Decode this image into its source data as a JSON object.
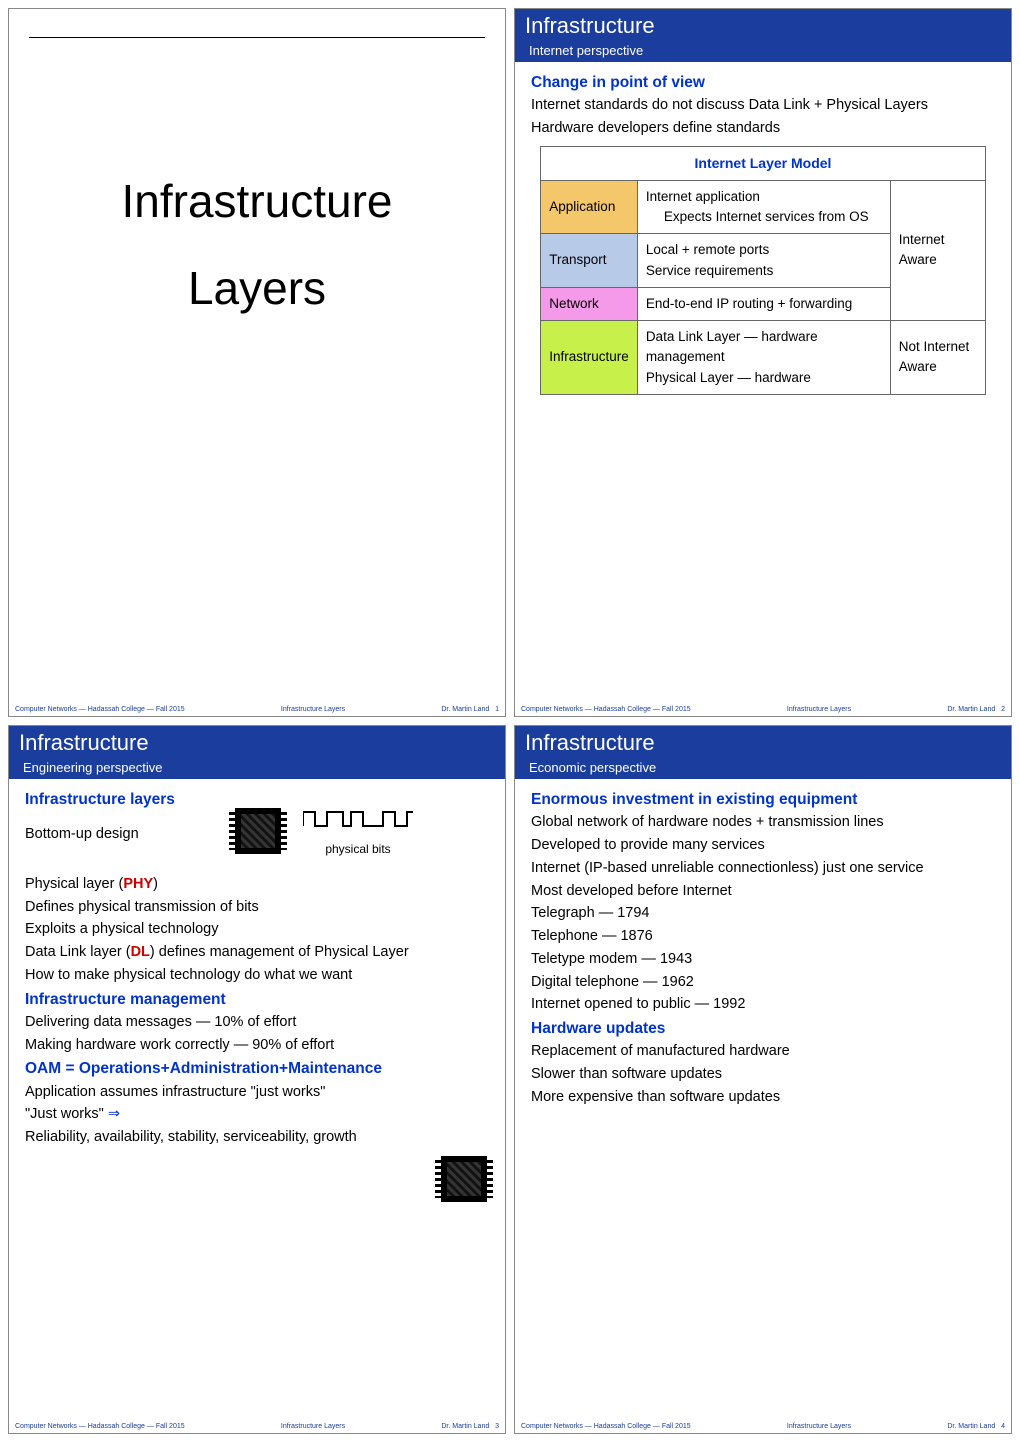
{
  "footer": {
    "left": "Computer Networks — Hadassah College — Fall 2015",
    "center": "Infrastructure Layers",
    "right": "Dr. Martin Land"
  },
  "slide1": {
    "title_line1": "Infrastructure",
    "title_line2": "Layers",
    "page": "1"
  },
  "slide2": {
    "hdr": "Infrastructure",
    "sub": "Internet perspective",
    "h1": "Change in point of view",
    "p1": "Internet standards do not discuss Data Link + Physical Layers",
    "p2": "Hardware developers define standards",
    "table_caption": "Internet Layer Model",
    "rows": [
      {
        "layer": "Application",
        "desc1": "Internet application",
        "desc2": "Expects Internet services from OS"
      },
      {
        "layer": "Transport",
        "desc1": "Local + remote ports",
        "desc2": "Service requirements"
      },
      {
        "layer": "Network",
        "desc1": "End-to-end IP routing + forwarding",
        "desc2": ""
      },
      {
        "layer": "Infrastructure",
        "desc1": "Data Link Layer — hardware management",
        "desc2": "Physical Layer — hardware"
      }
    ],
    "right_top": "Internet Aware",
    "right_bot": "Not Internet Aware",
    "page": "2"
  },
  "slide3": {
    "hdr": "Infrastructure",
    "sub": "Engineering perspective",
    "h1": "Infrastructure layers",
    "p1": "Bottom-up design",
    "p2a": "Physical layer (",
    "p2b": "PHY",
    "p2c": ")",
    "p3": "Defines physical transmission of bits",
    "p4": "Exploits a physical technology",
    "p5a": "Data Link layer (",
    "p5b": "DL",
    "p5c": ") defines management of Physical Layer",
    "p6": "How to make physical technology do what we want",
    "h2": "Infrastructure management",
    "p7": "Delivering data messages — 10% of effort",
    "p8": "Making hardware work correctly — 90% of effort",
    "h3": "OAM = Operations+Administration+Maintenance",
    "p9": "Application assumes infrastructure \"just works\"",
    "p10a": "\"Just works\" ",
    "p10b": "⇒",
    "p11": "Reliability, availability, stability, serviceability, growth",
    "sig_wave": "⨅⨅_⨅⨅⎺⨅⨅⨅",
    "sig_label": "physical bits",
    "page": "3"
  },
  "slide4": {
    "hdr": "Infrastructure",
    "sub": "Economic perspective",
    "h1": "Enormous investment in existing equipment",
    "p1": "Global network of hardware nodes + transmission lines",
    "p2": "Developed to provide many services",
    "p3": "Internet (IP-based unreliable connectionless) just one service",
    "p4": "Most developed before Internet",
    "p5": "Telegraph — 1794",
    "p6": "Telephone — 1876",
    "p7": "Teletype modem — 1943",
    "p8": "Digital telephone — 1962",
    "p9": "Internet opened to public — 1992",
    "h2": "Hardware updates",
    "p10": "Replacement of manufactured hardware",
    "p11": "Slower than software updates",
    "p12": "More expensive than software updates",
    "page": "4"
  }
}
